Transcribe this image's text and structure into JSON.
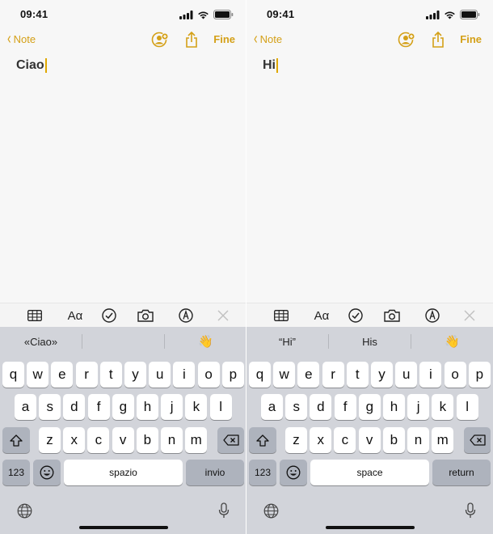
{
  "colors": {
    "accent": "#d4a017",
    "keyboard_bg": "#d2d4da",
    "key_dark": "#aeb3bd"
  },
  "panels": [
    {
      "status": {
        "time": "09:41"
      },
      "nav": {
        "back_label": "Note",
        "done_label": "Fine"
      },
      "note": {
        "text": "Ciao"
      },
      "suggestions": [
        "«Ciao»",
        "",
        "👋"
      ],
      "keys": {
        "numbers": "123",
        "space": "spazio",
        "return": "invio"
      }
    },
    {
      "status": {
        "time": "09:41"
      },
      "nav": {
        "back_label": "Note",
        "done_label": "Fine"
      },
      "note": {
        "text": "Hi"
      },
      "suggestions": [
        "“Hi”",
        "His",
        "👋"
      ],
      "keys": {
        "numbers": "123",
        "space": "space",
        "return": "return"
      }
    }
  ],
  "keyboard_rows": {
    "row1": [
      "q",
      "w",
      "e",
      "r",
      "t",
      "y",
      "u",
      "i",
      "o",
      "p"
    ],
    "row2": [
      "a",
      "s",
      "d",
      "f",
      "g",
      "h",
      "j",
      "k",
      "l"
    ],
    "row3": [
      "z",
      "x",
      "c",
      "v",
      "b",
      "n",
      "m"
    ]
  },
  "icons": {
    "toolbar": [
      "table-icon",
      "text-format-icon",
      "checklist-icon",
      "camera-icon",
      "markup-icon",
      "close-icon"
    ],
    "toolbar_text_format": "Aα"
  }
}
